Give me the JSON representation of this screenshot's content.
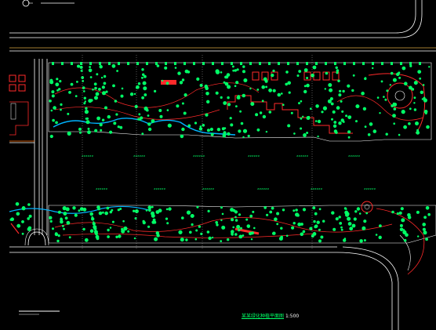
{
  "drawing": {
    "title_main": "某某绿化种植平面图",
    "title_scale": "1:500",
    "road_labels": [
      "######",
      "######",
      "######",
      "######",
      "######",
      "######",
      "######",
      "######",
      "######",
      "######",
      "######",
      "######"
    ],
    "colors": {
      "background": "#000000",
      "linework": "#ffffff",
      "planting": "#00ff66",
      "paths": "#ff2a2a",
      "water": "#00b4ff",
      "grid": "#ffffff"
    },
    "icon_names": [
      "tree-symbol-icon",
      "compass-icon"
    ]
  }
}
